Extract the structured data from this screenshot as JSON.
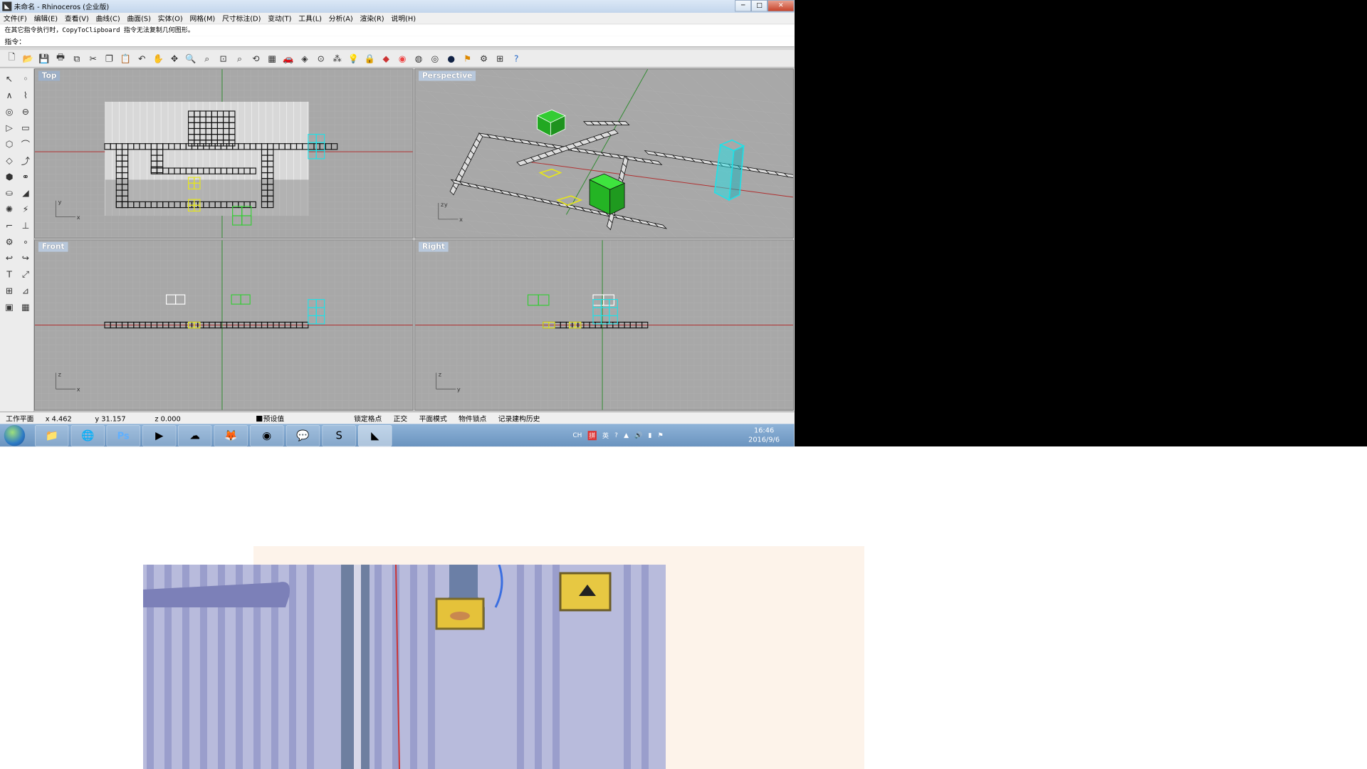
{
  "window": {
    "title": "未命名 - Rhinoceros (企业版)",
    "buttons": {
      "minimize": "─",
      "maximize": "□",
      "close": "✕"
    }
  },
  "menu": [
    "文件(F)",
    "编辑(E)",
    "查看(V)",
    "曲线(C)",
    "曲面(S)",
    "实体(O)",
    "网格(M)",
    "尺寸标注(D)",
    "变动(T)",
    "工具(L)",
    "分析(A)",
    "渲染(R)",
    "说明(H)"
  ],
  "command": {
    "history": "在其它指令执行时，CopyToClipboard 指令无法复制几何图形。",
    "prompt_label": "指令：",
    "input_value": ""
  },
  "viewports": {
    "top": "Top",
    "perspective": "Perspective",
    "front": "Front",
    "right": "Right"
  },
  "axes": {
    "top": {
      "a": "y",
      "b": "x"
    },
    "persp": {
      "a": "z",
      "b": "y",
      "c": "x"
    },
    "front": {
      "a": "z",
      "b": "x"
    },
    "right": {
      "a": "z",
      "b": "y"
    }
  },
  "status": {
    "cplane": "工作平面",
    "x": "x 4.462",
    "y": "y 31.157",
    "z": "z 0.000",
    "layer": "预设值",
    "snap": "锁定格点",
    "ortho": "正交",
    "planar": "平面模式",
    "osnap": "物件锁点",
    "history": "记录建构历史"
  },
  "taskbar": {
    "tray": [
      "CH",
      "拼",
      "英"
    ],
    "time": "16:46",
    "date": "2016/9/6"
  },
  "colors": {
    "grid": "#b0b0b0",
    "viewport_bg": "#a8a8a8",
    "x_axis": "#b03030",
    "y_axis": "#2f8a2f",
    "cyan": "#22e0e6",
    "green": "#33cc33",
    "yellow": "#e6e61a"
  },
  "icons": {
    "toolbar": [
      "new-icon",
      "open-icon",
      "save-icon",
      "print-icon",
      "export-icon",
      "cut-icon",
      "copy-icon",
      "paste-icon",
      "undo-icon",
      "pan-icon",
      "move-icon",
      "zoom-icon",
      "zoom-window-icon",
      "zoom-extents-icon",
      "rotate-icon",
      "grid-icon",
      "car-icon",
      "shade-icon",
      "snap-icon",
      "light-icon",
      "lock-icon",
      "render-icon",
      "color-icon",
      "sphere-icon",
      "globe-icon",
      "material-icon",
      "settings-icon",
      "options-icon",
      "help-icon"
    ]
  }
}
